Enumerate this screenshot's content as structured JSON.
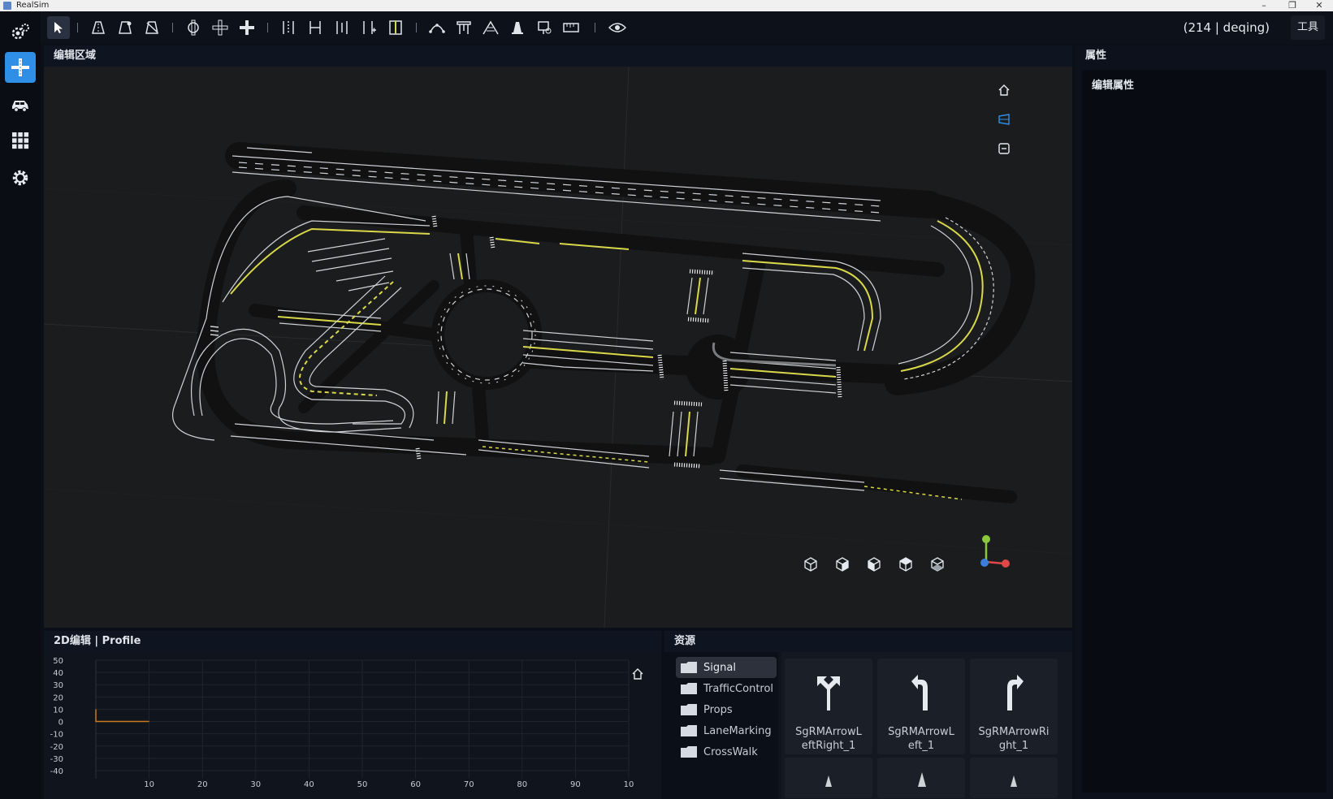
{
  "window": {
    "title": "RealSim"
  },
  "toolbar": {
    "status": "(214 | deqing)",
    "tools_label": "工具"
  },
  "edit_panel": {
    "title": "编辑区域"
  },
  "properties_panel": {
    "title": "属性",
    "subtitle": "编辑属性"
  },
  "profile_panel": {
    "title": "2D编辑 | Profile",
    "chart_data": {
      "type": "line",
      "title": "",
      "xlabel": "",
      "ylabel": "",
      "xlim": [
        0,
        100
      ],
      "ylim": [
        -40,
        50
      ],
      "x_ticks": [
        "10",
        "20",
        "30",
        "40",
        "50",
        "60",
        "70",
        "80",
        "90",
        "10"
      ],
      "y_ticks": [
        "50",
        "40",
        "30",
        "20",
        "10",
        "0",
        "-10",
        "-20",
        "-30",
        "-40"
      ],
      "grid": true,
      "series": [
        {
          "x": [
            0,
            0,
            10
          ],
          "y": [
            10,
            0,
            0
          ],
          "color": "#c87a1e"
        }
      ]
    }
  },
  "assets_panel": {
    "title": "资源",
    "folders": [
      "Signal",
      "TrafficControl",
      "Props",
      "LaneMarking",
      "CrossWalk"
    ],
    "selected_folder": "Signal",
    "items": [
      {
        "label": "SgRMArrowLeftRight_1",
        "line1": "SgRMArrowL",
        "line2": "eftRight_1",
        "icon": "arrow-left-right-icon"
      },
      {
        "label": "SgRMArrowLeft_1",
        "line1": "SgRMArrowL",
        "line2": "eft_1",
        "icon": "arrow-left-icon"
      },
      {
        "label": "SgRMArrowRight_1",
        "line1": "SgRMArrowRi",
        "line2": "ght_1",
        "icon": "arrow-right-icon"
      }
    ]
  },
  "colors": {
    "accent": "#2f8ee6",
    "background": "#0b0f17",
    "viewport": "#1b1c1d",
    "lane_yellow": "#d8d84a",
    "road": "#141414"
  }
}
